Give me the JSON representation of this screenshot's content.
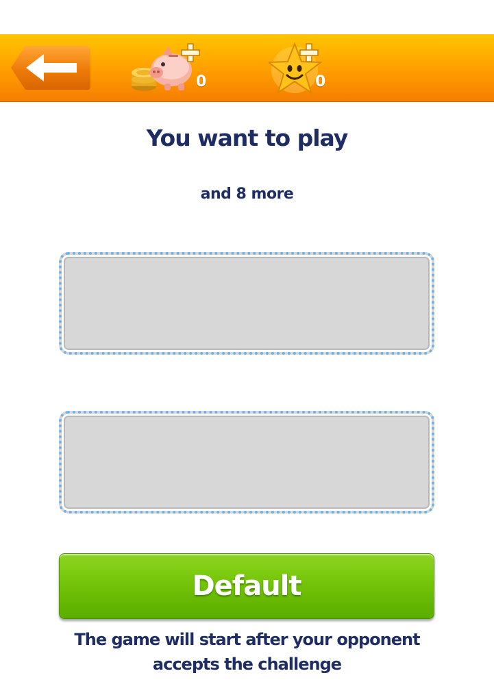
{
  "header": {
    "back_label": "",
    "coins_count": "0",
    "stars_count": "0",
    "coins_icon": "piggy-bank-coins-plus-icon",
    "stars_icon": "smiling-star-plus-icon",
    "back_icon": "arrow-left-icon"
  },
  "main": {
    "title": "You want to play",
    "subtitle": "and 8 more",
    "slots": [
      "",
      ""
    ]
  },
  "actions": {
    "default_label": "Default"
  },
  "footer": {
    "note": "The game will start after your opponent accepts the challenge"
  },
  "colors": {
    "topbar": "#ff9d00",
    "text": "#1e2d63",
    "button_green": "#6cbd05",
    "slot_border": "#6fb2e8",
    "slot_fill": "#d7d7d7"
  }
}
